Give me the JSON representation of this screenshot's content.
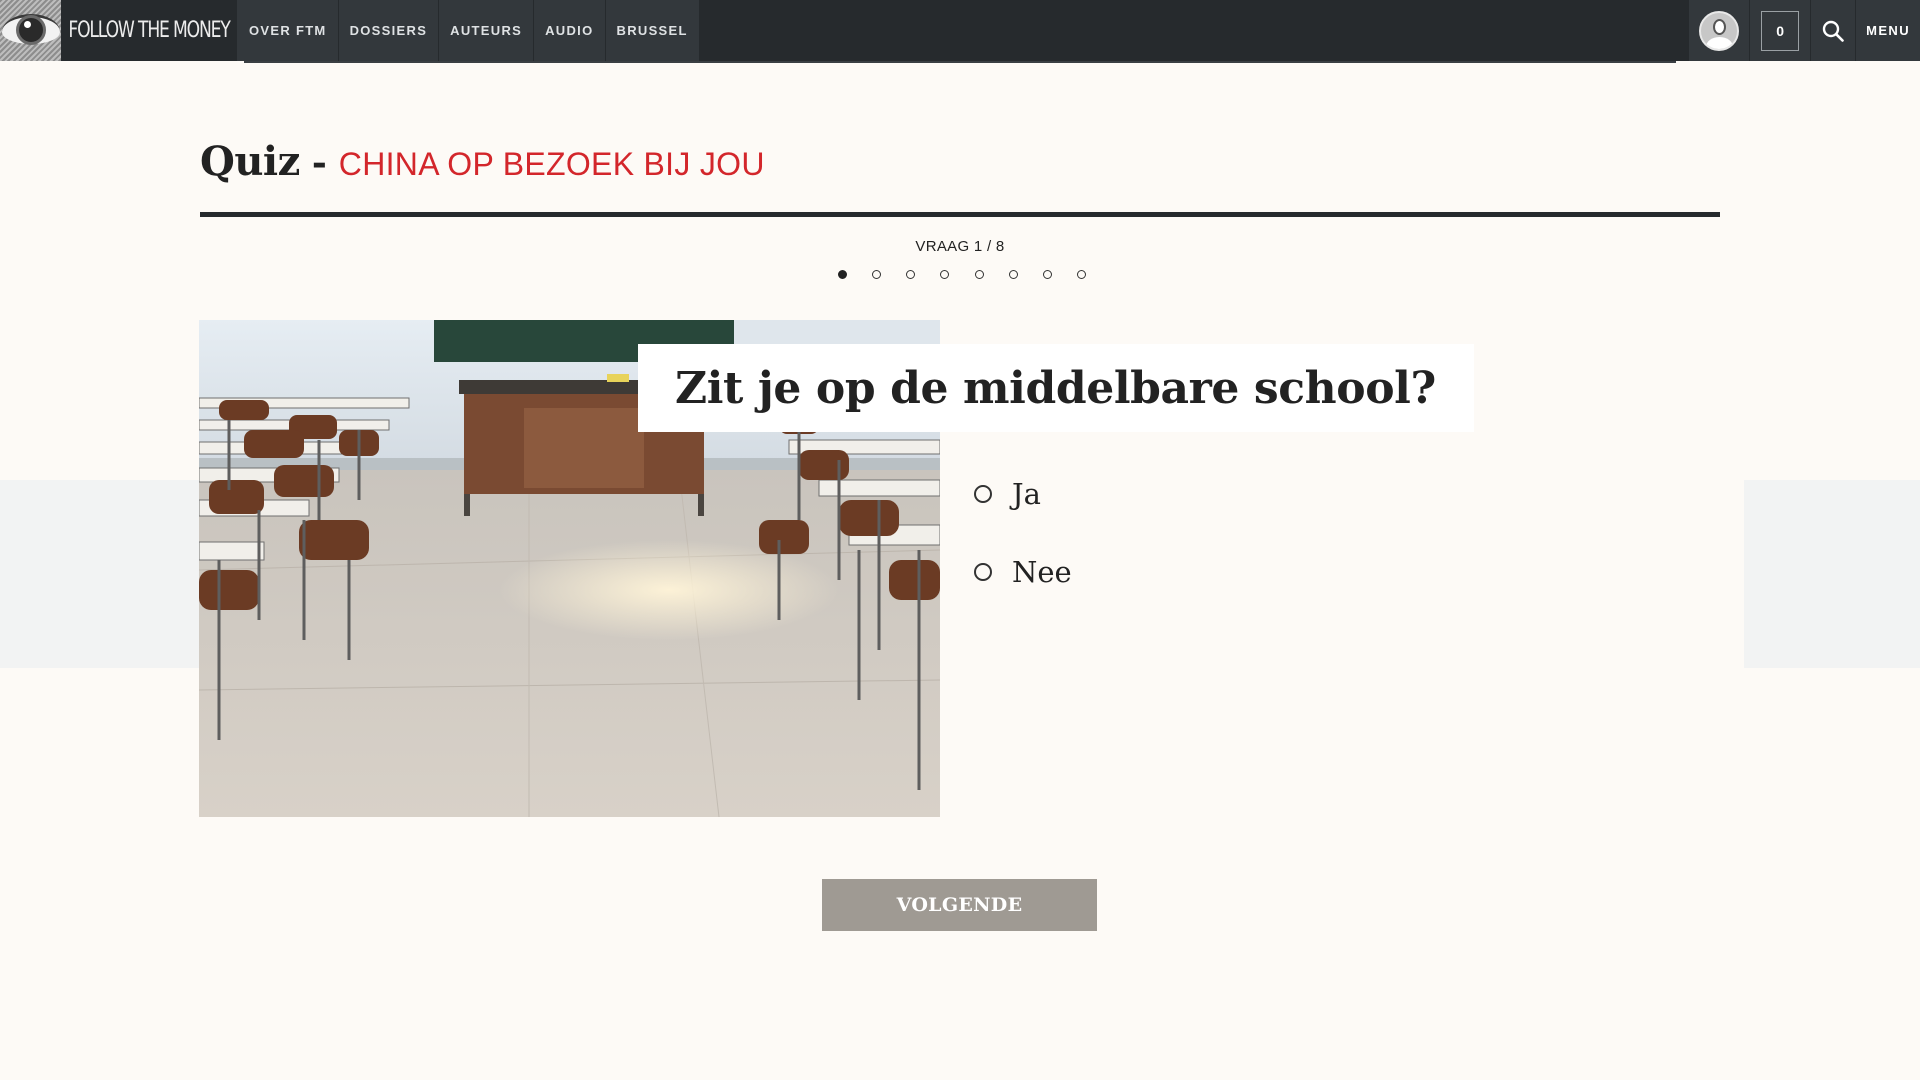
{
  "brand": {
    "name": "FOLLOW THE MONEY"
  },
  "nav": {
    "items": [
      {
        "label": "OVER FTM"
      },
      {
        "label": "DOSSIERS"
      },
      {
        "label": "AUTEURS"
      },
      {
        "label": "AUDIO"
      },
      {
        "label": "BRUSSEL"
      }
    ],
    "cart_count": "0",
    "menu_label": "MENU",
    "icons": {
      "account": "user-avatar-icon",
      "search": "search-icon"
    }
  },
  "quiz": {
    "title_word": "Quiz",
    "title_dash": "-",
    "topic": "CHINA OP BEZOEK BIJ JOU",
    "progress_label": "VRAAG 1 / 8",
    "question_count": 8,
    "current_question": 1,
    "question": "Zit je op de middelbare school?",
    "answers": [
      {
        "label": "Ja"
      },
      {
        "label": "Nee"
      }
    ],
    "next_label": "VOLGENDE"
  },
  "colors": {
    "topbar": "#262a2d",
    "accent_red": "#d3262b",
    "background": "#fdfaf6",
    "button": "#9f9a93"
  }
}
